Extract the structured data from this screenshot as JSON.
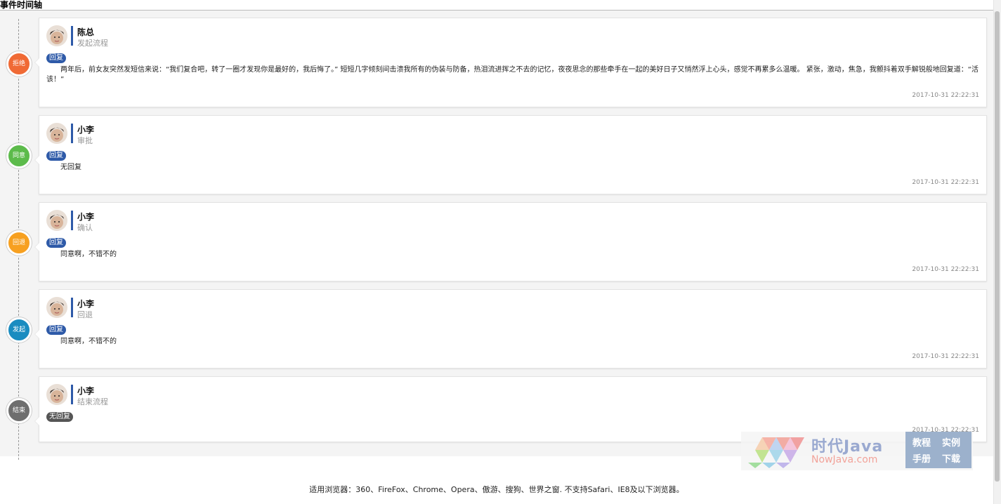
{
  "page_title": "事件时间轴",
  "events": [
    {
      "status": "拒绝",
      "status_color": "#f06a35",
      "user": "陈总",
      "action": "发起流程",
      "tag": "回复",
      "content": "两年后，前女友突然发短信来说：“我们复合吧，转了一圈才发现你是最好的，我后悔了。” 短短几字倾刻间击溃我所有的伪装与防备，热泪流进挥之不去的记忆，夜夜思念的那些牵手在一起的美好日子又悄然浮上心头，感觉不再累多么温暖。 紧张，激动，焦急，我颤抖着双手解锐般地回复道：“活该！”",
      "time": "2017-10-31 22:22:31"
    },
    {
      "status": "同意",
      "status_color": "#5cbb4b",
      "user": "小李",
      "action": "审批",
      "tag": "回复",
      "content": "无回复",
      "time": "2017-10-31 22:22:31"
    },
    {
      "status": "回退",
      "status_color": "#f7a020",
      "user": "小李",
      "action": "确认",
      "tag": "回复",
      "content": "同意啊，不错不的",
      "time": "2017-10-31 22:22:31"
    },
    {
      "status": "发起",
      "status_color": "#1a8cc0",
      "user": "小李",
      "action": "回退",
      "tag": "回复",
      "content": "同意啊，不错不的",
      "time": "2017-10-31 22:22:31"
    },
    {
      "status": "结束",
      "status_color": "#6e6e6e",
      "user": "小李",
      "action": "结束流程",
      "tag": "无回复",
      "content": "",
      "time": "2017-10-31 22:22:31"
    }
  ],
  "watermark": {
    "title": "时代Java",
    "subtitle": "NowJava.com",
    "links": [
      "教程",
      "实例",
      "手册",
      "下载"
    ]
  },
  "footer": "适用浏览器：360、FireFox、Chrome、Opera、傲游、搜狗、世界之窗. 不支持Safari、IE8及以下浏览器。"
}
